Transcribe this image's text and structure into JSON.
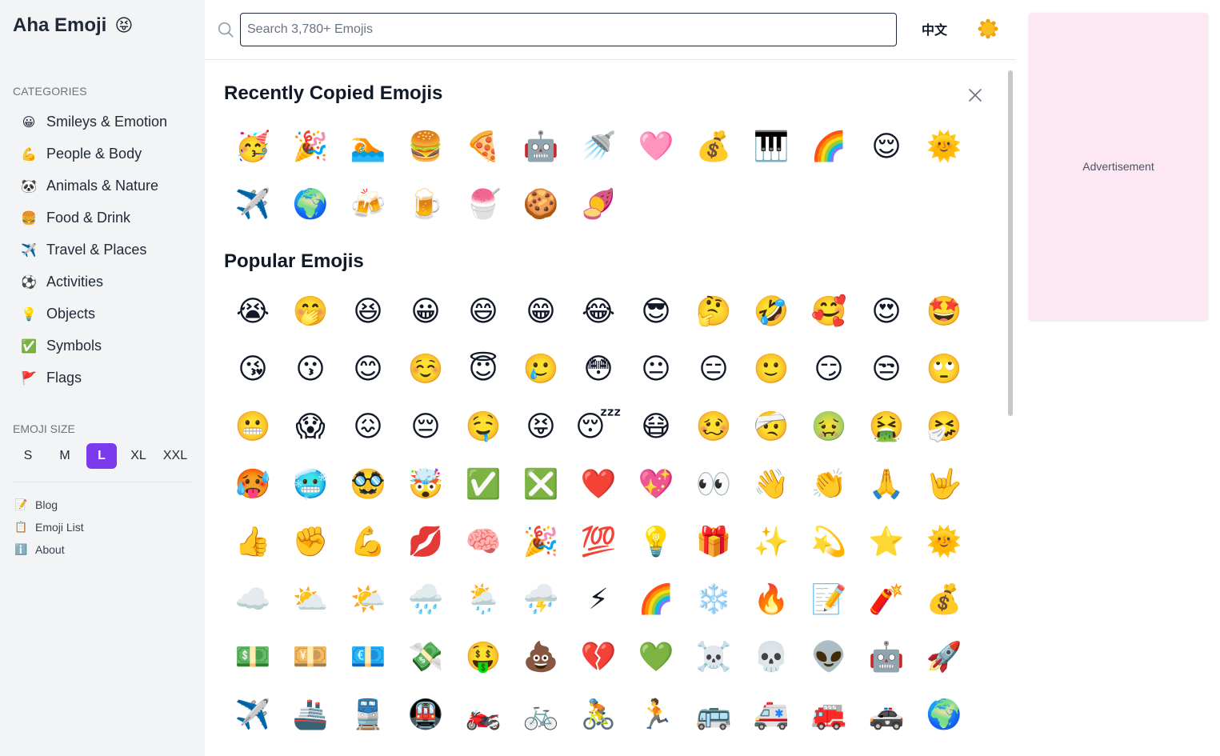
{
  "brand": {
    "name": "Aha Emoji",
    "emoji": "😝"
  },
  "sidebar": {
    "categories_label": "CATEGORIES",
    "categories": [
      {
        "icon": "😀",
        "label": "Smileys & Emotion"
      },
      {
        "icon": "💪",
        "label": "People & Body"
      },
      {
        "icon": "🐼",
        "label": "Animals & Nature"
      },
      {
        "icon": "🍔",
        "label": "Food & Drink"
      },
      {
        "icon": "✈️",
        "label": "Travel & Places"
      },
      {
        "icon": "⚽",
        "label": "Activities"
      },
      {
        "icon": "💡",
        "label": "Objects"
      },
      {
        "icon": "✅",
        "label": "Symbols"
      },
      {
        "icon": "🚩",
        "label": "Flags"
      }
    ],
    "size_label": "EMOJI SIZE",
    "sizes": [
      "S",
      "M",
      "L",
      "XL",
      "XXL"
    ],
    "active_size": "L",
    "links": [
      {
        "icon": "📝",
        "label": "Blog"
      },
      {
        "icon": "📋",
        "label": "Emoji List"
      },
      {
        "icon": "ℹ️",
        "label": "About"
      }
    ]
  },
  "header": {
    "search_placeholder": "Search 3,780+ Emojis",
    "search_value": "",
    "language": "中文",
    "theme_icon": "sun-icon"
  },
  "recent": {
    "title": "Recently Copied Emojis",
    "emojis": [
      "🥳",
      "🎉",
      "🏊",
      "🍔",
      "🍕",
      "🤖",
      "🚿",
      "🩷",
      "💰",
      "🎹",
      "🌈",
      "😌",
      "🌞",
      "✈️",
      "🌍",
      "🍻",
      "🍺",
      "🍧",
      "🍪",
      "🍠"
    ]
  },
  "popular": {
    "title": "Popular Emojis",
    "emojis": [
      "😭",
      "🤭",
      "😆",
      "😀",
      "😄",
      "😁",
      "😂",
      "😎",
      "🤔",
      "🤣",
      "🥰",
      "😍",
      "🤩",
      "😘",
      "😗",
      "😊",
      "☺️",
      "😇",
      "🥲",
      "😳",
      "😐",
      "😑",
      "🙂",
      "😏",
      "😒",
      "🙄",
      "😬",
      "😱",
      "😖",
      "😔",
      "🤤",
      "😝",
      "😴",
      "😷",
      "🥴",
      "🤕",
      "🤢",
      "🤮",
      "🤧",
      "🥵",
      "🥶",
      "🥸",
      "🤯",
      "✅",
      "❎",
      "❤️",
      "💖",
      "👀",
      "👋",
      "👏",
      "🙏",
      "🤟",
      "👍",
      "✊",
      "💪",
      "💋",
      "🧠",
      "🎉",
      "💯",
      "💡",
      "🎁",
      "✨",
      "💫",
      "⭐",
      "🌞",
      "☁️",
      "⛅",
      "🌤️",
      "🌧️",
      "🌦️",
      "⛈️",
      "⚡",
      "🌈",
      "❄️",
      "🔥",
      "📝",
      "🧨",
      "💰",
      "💵",
      "💴",
      "💶",
      "💸",
      "🤑",
      "💩",
      "💔",
      "💚",
      "☠️",
      "💀",
      "👽",
      "🤖",
      "🚀",
      "✈️",
      "🚢",
      "🚆",
      "🚇",
      "🏍️",
      "🚲",
      "🚴",
      "🏃",
      "🚌",
      "🚑",
      "🚒",
      "🚓",
      "🌍"
    ]
  },
  "ad": {
    "label": "Advertisement"
  }
}
